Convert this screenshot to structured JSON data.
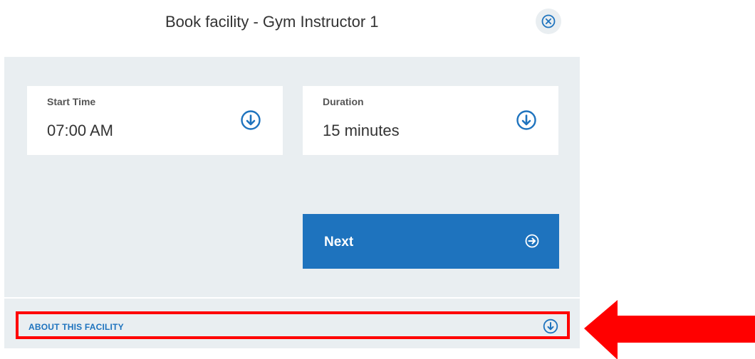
{
  "modal": {
    "title": "Book facility - Gym Instructor 1"
  },
  "form": {
    "start_time": {
      "label": "Start Time",
      "value": "07:00 AM",
      "icon": "chevron-down-circle-icon"
    },
    "duration": {
      "label": "Duration",
      "value": "15 minutes",
      "icon": "chevron-down-circle-icon"
    },
    "next_button": {
      "label": "Next",
      "icon": "arrow-right-circle-icon"
    }
  },
  "about": {
    "label": "ABOUT THIS FACILITY",
    "icon": "chevron-down-circle-icon"
  },
  "colors": {
    "accent": "#1e73be",
    "panel_background": "#e9eef1",
    "highlight": "#ff0000"
  }
}
